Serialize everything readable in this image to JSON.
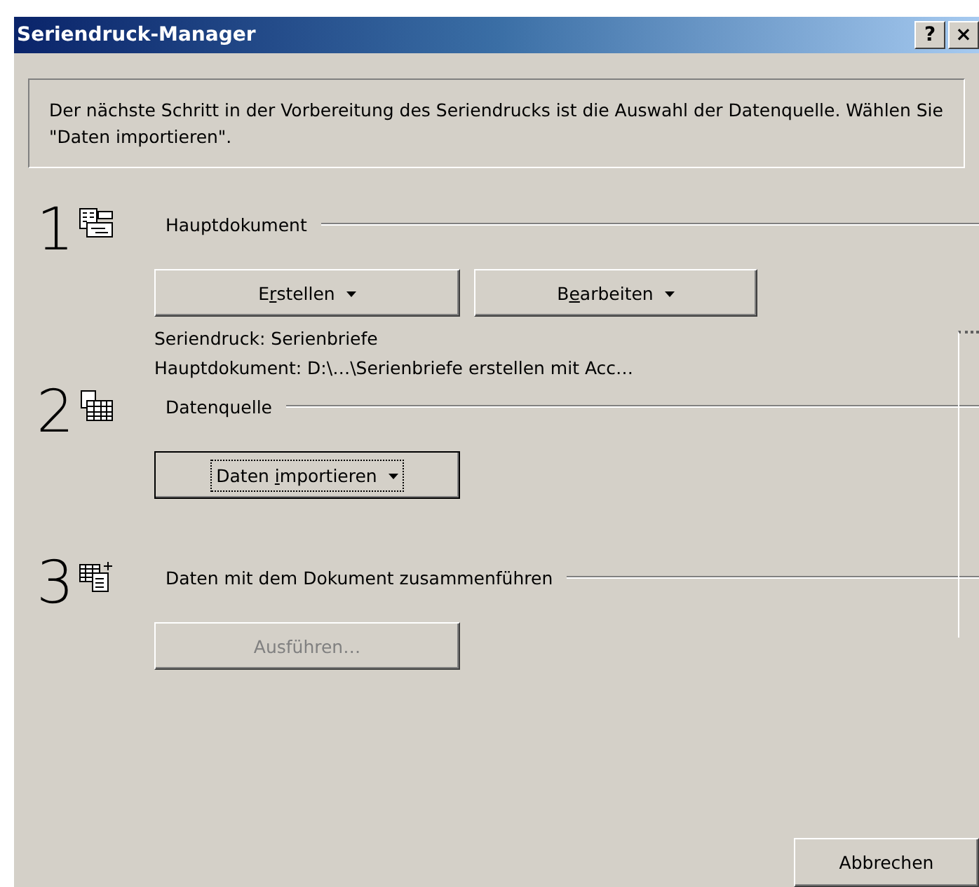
{
  "window": {
    "title": "Seriendruck-Manager",
    "title_buttons": [
      "?",
      "×"
    ]
  },
  "message": "Der nächste Schritt in der Vorbereitung des Seriendrucks ist die Auswahl der Datenquelle. Wählen Sie \"Daten importieren\".",
  "steps": [
    {
      "number": "1",
      "heading": "Hauptdokument",
      "buttons": [
        {
          "before": "E",
          "mnemonic": "r",
          "after": "stellen",
          "dropdown": true,
          "disabled": false,
          "focused": false
        },
        {
          "before": "B",
          "mnemonic": "e",
          "after": "arbeiten",
          "dropdown": true,
          "disabled": false,
          "focused": false
        }
      ],
      "info": [
        "Seriendruck: Serienbriefe",
        "Hauptdokument: D:\\…\\Serienbriefe erstellen mit Acc…"
      ]
    },
    {
      "number": "2",
      "heading": "Datenquelle",
      "buttons": [
        {
          "before": "Daten ",
          "mnemonic": "i",
          "after": "mportieren",
          "dropdown": true,
          "disabled": false,
          "focused": true
        }
      ]
    },
    {
      "number": "3",
      "heading": "Daten mit dem Dokument zusammenführen",
      "buttons": [
        {
          "before": "Ausführen…",
          "dropdown": false,
          "disabled": true,
          "focused": false
        }
      ]
    }
  ],
  "cancel": "Abbrechen"
}
